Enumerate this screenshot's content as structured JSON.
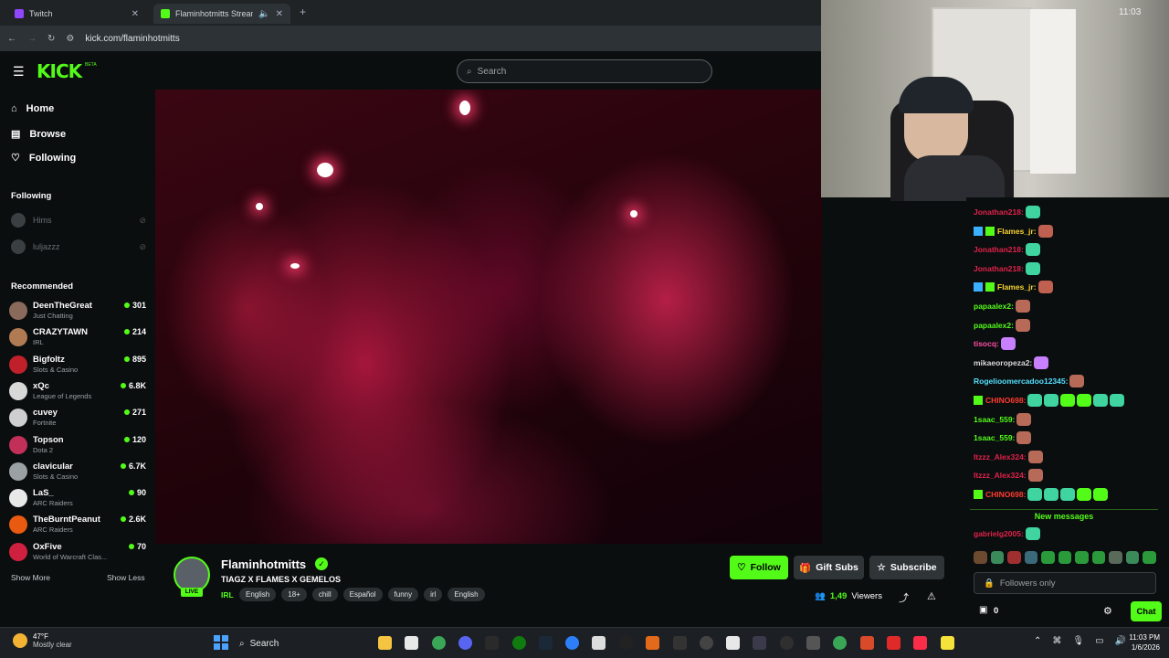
{
  "browser": {
    "tabs": [
      {
        "title": "Twitch",
        "favicon_color": "#9146ff"
      },
      {
        "title": "Flaminhotmitts Stream - W",
        "favicon_color": "#53fc18"
      }
    ],
    "new_tab": "+",
    "url": "kick.com/flaminhotmitts"
  },
  "header": {
    "logo": "KICK",
    "logo_suffix": "BETA",
    "search_placeholder": "Search"
  },
  "nav": [
    {
      "label": "Home",
      "icon": "home-icon"
    },
    {
      "label": "Browse",
      "icon": "browse-icon"
    },
    {
      "label": "Following",
      "icon": "heart-icon"
    }
  ],
  "following": {
    "heading": "Following",
    "items": [
      {
        "name": "Hims"
      },
      {
        "name": "luljazzz"
      }
    ]
  },
  "recommended": {
    "heading": "Recommended",
    "items": [
      {
        "name": "DeenTheGreat",
        "category": "Just Chatting",
        "viewers": "301",
        "color": "#8a6a5a"
      },
      {
        "name": "CRAZYTAWN",
        "category": "IRL",
        "viewers": "214",
        "color": "#b07a52"
      },
      {
        "name": "Bigfoltz",
        "category": "Slots & Casino",
        "viewers": "895",
        "color": "#c0202a"
      },
      {
        "name": "xQc",
        "category": "League of Legends",
        "viewers": "6.8K",
        "color": "#d8d8d8"
      },
      {
        "name": "cuvey",
        "category": "Fortnite",
        "viewers": "271",
        "color": "#cfcfd2"
      },
      {
        "name": "Topson",
        "category": "Dota 2",
        "viewers": "120",
        "color": "#c2305a"
      },
      {
        "name": "clavicular",
        "category": "Slots & Casino",
        "viewers": "6.7K",
        "color": "#9aa0a4"
      },
      {
        "name": "LaS_",
        "category": "ARC Raiders",
        "viewers": "90",
        "color": "#e8e8e8"
      },
      {
        "name": "TheBurntPeanut",
        "category": "ARC Raiders",
        "viewers": "2.6K",
        "color": "#e85a10"
      },
      {
        "name": "OxFive",
        "category": "World of Warcraft Clas...",
        "viewers": "70",
        "color": "#d02040"
      }
    ],
    "show_more": "Show More",
    "show_less": "Show Less"
  },
  "webcam": {
    "clock_text": "11:03"
  },
  "chat": {
    "messages": [
      {
        "user": "Jonathan218:",
        "color": "#e0224a",
        "emotes": [
          "#3fd4a0"
        ]
      },
      {
        "user": "Flames_jr:",
        "color": "#f5d330",
        "badges": [
          "#3ab0ff",
          "#53fc18"
        ],
        "emotes": [
          "#c06050"
        ]
      },
      {
        "user": "Jonathan218:",
        "color": "#e0224a",
        "emotes": [
          "#3fd4a0"
        ]
      },
      {
        "user": "Jonathan218:",
        "color": "#e0224a",
        "emotes": [
          "#3fd4a0"
        ]
      },
      {
        "user": "Flames_jr:",
        "color": "#f5d330",
        "badges": [
          "#3ab0ff",
          "#53fc18"
        ],
        "emotes": [
          "#c06050"
        ]
      },
      {
        "user": "papaalex2:",
        "color": "#53fc18",
        "emotes": [
          "#b86a58"
        ]
      },
      {
        "user": "papaalex2:",
        "color": "#53fc18",
        "emotes": [
          "#b86a58"
        ]
      },
      {
        "user": "tisocq:",
        "color": "#ff4da6",
        "emotes": [
          "#c880ff"
        ]
      },
      {
        "user": "mikaeoropeza2:",
        "color": "#d8d8d8",
        "emotes": [
          "#c880ff"
        ]
      },
      {
        "user": "Rogelioomercadoo12345:",
        "color": "#53e0ff",
        "emotes": [
          "#b86a58"
        ]
      },
      {
        "user": "CHINO698:",
        "color": "#ff3b30",
        "badges": [
          "#53fc18"
        ],
        "emotes": [
          "#3fd4a0",
          "#3fd4a0",
          "#53fc18",
          "#53fc18",
          "#3fd4a0",
          "#3fd4a0"
        ]
      },
      {
        "user": "1saac_559:",
        "color": "#53fc18",
        "emotes": [
          "#b86a58"
        ]
      },
      {
        "user": "1saac_559:",
        "color": "#53fc18",
        "emotes": [
          "#b86a58"
        ]
      },
      {
        "user": "Itzzz_Alex324:",
        "color": "#e0224a",
        "emotes": [
          "#b86a58"
        ]
      },
      {
        "user": "Itzzz_Alex324:",
        "color": "#e0224a",
        "emotes": [
          "#b86a58"
        ]
      },
      {
        "user": "CHINO698:",
        "color": "#ff3b30",
        "badges": [
          "#53fc18"
        ],
        "emotes": [
          "#3fd4a0",
          "#3fd4a0",
          "#3fd4a0",
          "#53fc18",
          "#53fc18"
        ]
      }
    ],
    "new_messages": "New messages",
    "last_message": {
      "user": "gabrielg2005:",
      "color": "#e0224a"
    },
    "followers_only": "Followers only",
    "points": "0",
    "chat_button": "Chat"
  },
  "channel": {
    "name": "Flaminhotmitts",
    "live_label": "LIVE",
    "title": "TIAGZ X FLAMES X GEMELOS",
    "category": "IRL",
    "tags": [
      "English",
      "18+",
      "chill",
      "Español",
      "funny",
      "irl",
      "English"
    ],
    "follow_label": "Follow",
    "gift_label": "Gift Subs",
    "subscribe_label": "Subscribe",
    "viewer_count": "1,49",
    "viewers_label": "Viewers"
  },
  "taskbar": {
    "weather_temp": "47°F",
    "weather_desc": "Mostly clear",
    "search_label": "Search",
    "time": "11:03 PM",
    "date": "1/6/2026"
  },
  "colors": {
    "accent": "#53fc18",
    "background": "#0b0e0f"
  }
}
